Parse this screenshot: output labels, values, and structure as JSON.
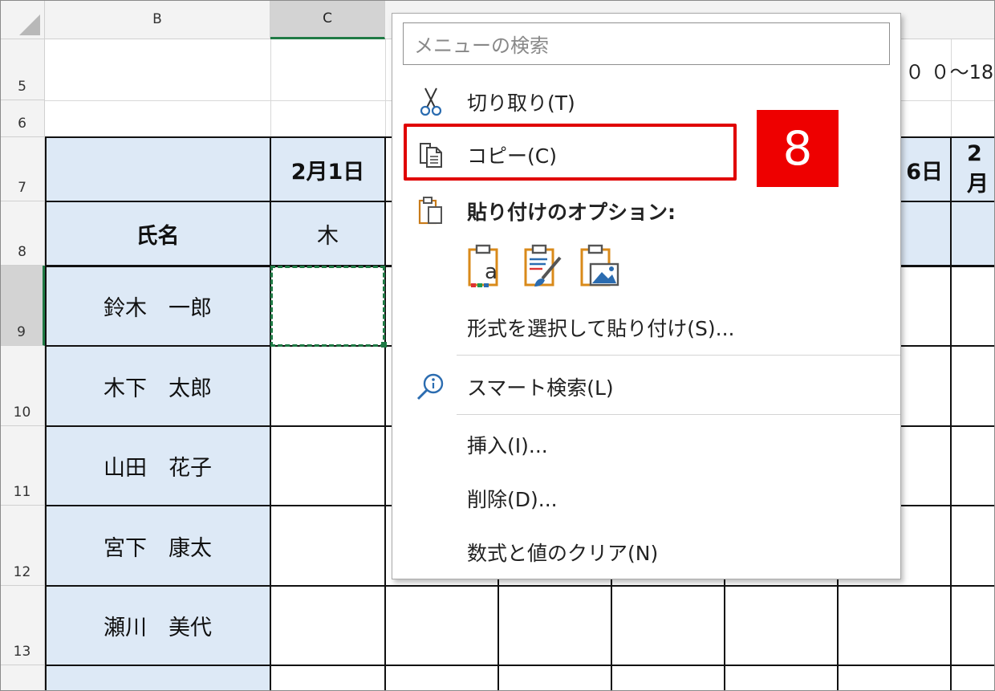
{
  "columns": {
    "B": "B",
    "C": "C"
  },
  "rows": [
    "5",
    "6",
    "7",
    "8",
    "9",
    "10",
    "11",
    "12",
    "13"
  ],
  "top_right_text": "０ ０～18",
  "header": {
    "dates": [
      "2月1日",
      "6日",
      "2月"
    ],
    "name_label": "氏名",
    "day_label": "木"
  },
  "names": [
    "鈴木　一郎",
    "木下　太郎",
    "山田　花子",
    "宮下　康太",
    "瀬川　美代"
  ],
  "menu": {
    "search_placeholder": "メニューの検索",
    "cut": "切り取り(T)",
    "copy": "コピー(C)",
    "paste_options": "貼り付けのオプション:",
    "paste_special": "形式を選択して貼り付け(S)...",
    "smart_lookup": "スマート検索(L)",
    "insert": "挿入(I)...",
    "delete": "削除(D)...",
    "clear": "数式と値のクリア(N)"
  },
  "step_badge": "8",
  "colors": {
    "accent_green": "#1f7a45",
    "header_blue": "#dde9f6",
    "highlight_red": "#e00000"
  },
  "icons": [
    "scissors-icon",
    "copy-icon",
    "paste-icon",
    "paste-values-icon",
    "paste-formatting-icon",
    "paste-picture-icon",
    "smart-lookup-icon"
  ]
}
